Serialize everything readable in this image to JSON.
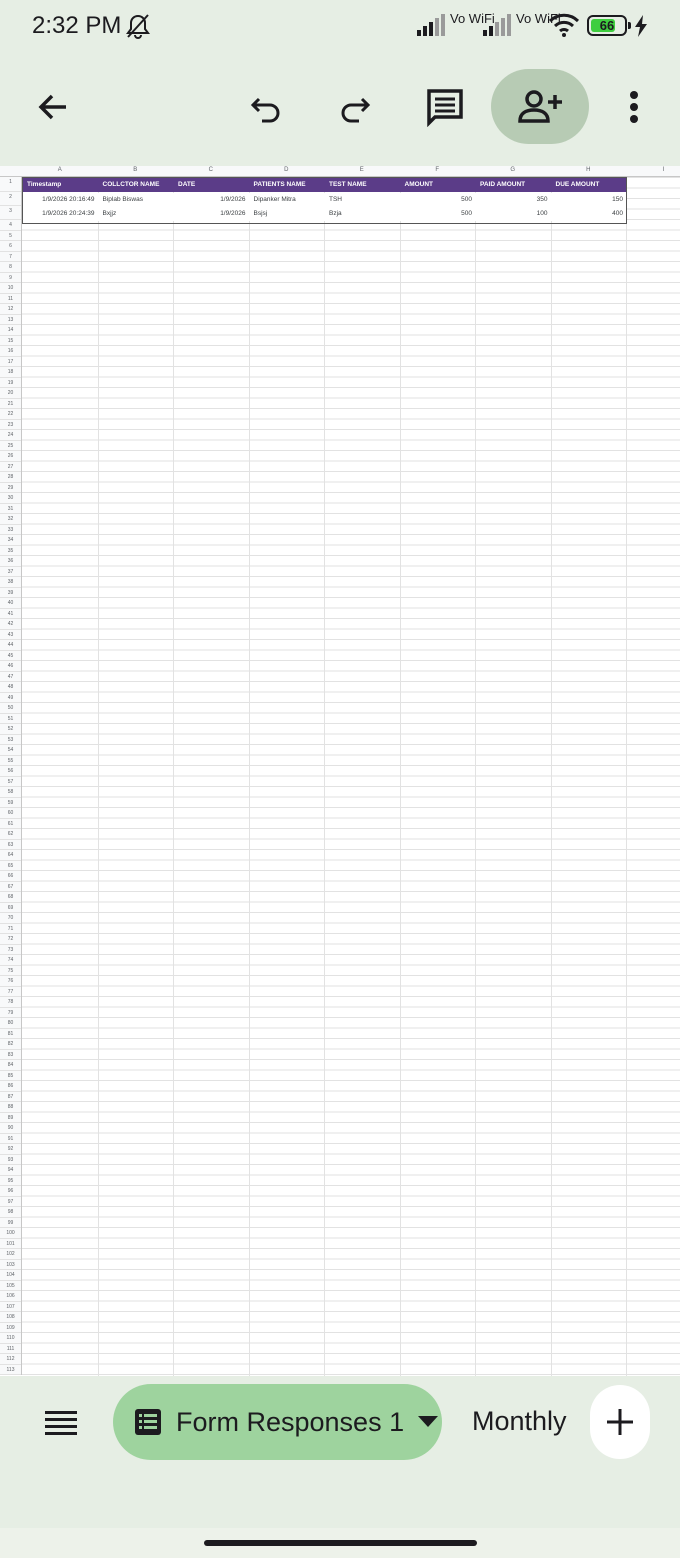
{
  "status_bar": {
    "time": "2:32 PM",
    "vowifi_1": "Vo WiFi",
    "vowifi_2": "Vo WiFi",
    "battery": "66"
  },
  "toolbar": {
    "back": "arrow-back-icon",
    "undo": "undo-icon",
    "redo": "redo-icon",
    "comments": "comment-icon",
    "share": "person-add-icon",
    "more": "more-vert-icon"
  },
  "sheet": {
    "column_letters": [
      "A",
      "B",
      "C",
      "D",
      "E",
      "F",
      "G",
      "H",
      "I"
    ],
    "headers": [
      "Timestamp",
      "COLLCTOR NAME",
      "DATE",
      "PATIENTS NAME",
      "TEST NAME",
      "AMOUNT",
      "PAID AMOUNT",
      "DUE AMOUNT"
    ],
    "rows": [
      [
        "1/9/2026 20:16:49",
        "Biplab Biswas",
        "1/9/2026",
        "Dipanker Mitra",
        "TSH",
        "500",
        "350",
        "150"
      ],
      [
        "1/9/2026 20:24:39",
        "Bxjjz",
        "1/9/2026",
        "Bsjsj",
        "Bzja",
        "500",
        "100",
        "400"
      ]
    ],
    "row_count": 113,
    "header_color": "#5b3c88"
  },
  "bottom_bar": {
    "menu": "sheets-list-icon",
    "active_tab": "Form Responses 1",
    "other_tab": "Monthly",
    "add": "add-sheet-icon"
  }
}
